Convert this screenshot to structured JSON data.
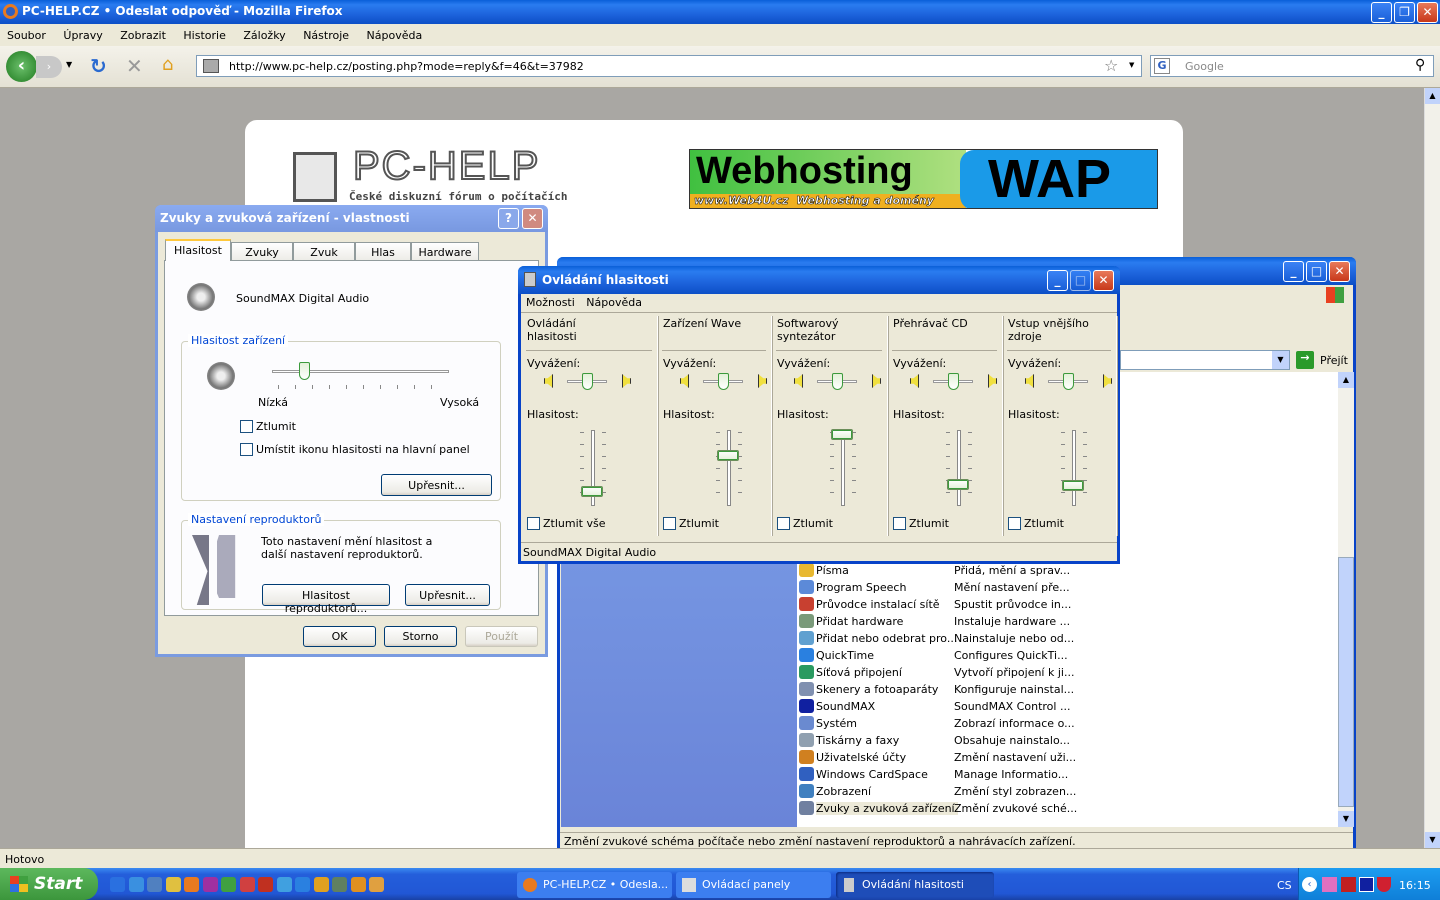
{
  "firefox": {
    "title": "PC-HELP.CZ • Odeslat odpověď - Mozilla Firefox",
    "menu": [
      "Soubor",
      "Úpravy",
      "Zobrazit",
      "Historie",
      "Záložky",
      "Nástroje",
      "Nápověda"
    ],
    "url": "http://www.pc-help.cz/posting.php?mode=reply&f=46&t=37982",
    "search_placeholder": "Google",
    "status": "Hotovo"
  },
  "page": {
    "logo_text": "PC-HELP",
    "logo_subtitle": "České diskuzní fórum o počítačích",
    "banner": {
      "main": "Webhosting",
      "sub": "www.Web4U.cz  Webhosting a domény",
      "right": "WAP"
    }
  },
  "sound_dialog": {
    "title": "Zvuky a zvuková zařízení - vlastnosti",
    "tabs": [
      "Hlasitost",
      "Zvuky",
      "Zvuk",
      "Hlas",
      "Hardware"
    ],
    "active_tab": 0,
    "device": "SoundMAX Digital Audio",
    "volume_group": "Hlasitost zařízení",
    "low": "Nízká",
    "high": "Vysoká",
    "volume_level": 0.18,
    "mute": "Ztlumit",
    "tray_icon": "Umístit ikonu hlasitosti na hlavní panel",
    "advanced": "Upřesnit...",
    "speaker_group": "Nastavení reproduktorů",
    "speaker_text": "Toto nastavení mění hlasitost a další nastavení reproduktorů.",
    "speaker_volume": "Hlasitost reproduktorů...",
    "speaker_advanced": "Upřesnit...",
    "ok": "OK",
    "cancel": "Storno",
    "apply": "Použít"
  },
  "mixer": {
    "title": "Ovládání hlasitosti",
    "menu": [
      "Možnosti",
      "Nápověda"
    ],
    "balance_label": "Vyvážení:",
    "volume_label": "Hlasitost:",
    "channels": [
      {
        "name": "Ovládání hlasitosti",
        "mute": "Ztlumit vše",
        "volume": 0.2
      },
      {
        "name": "Zařízení Wave",
        "mute": "Ztlumit",
        "volume": 0.67
      },
      {
        "name": "Softwarový syntezátor",
        "mute": "Ztlumit",
        "volume": 0.95
      },
      {
        "name": "Přehrávač CD",
        "mute": "Ztlumit",
        "volume": 0.29
      },
      {
        "name": "Vstup vnějšího zdroje",
        "mute": "Ztlumit",
        "volume": 0.27
      }
    ],
    "status": "SoundMAX Digital Audio"
  },
  "control_panel": {
    "go": "Přejít",
    "items": [
      {
        "name": "Písma",
        "desc": "Přidá, mění a sprav...",
        "color": "#e8b830"
      },
      {
        "name": "Program Speech",
        "desc": "Mění nastavení pře...",
        "color": "#5c8ad8"
      },
      {
        "name": "Průvodce instalací sítě",
        "desc": "Spustit průvodce in...",
        "color": "#c84030"
      },
      {
        "name": "Přidat hardware",
        "desc": "Instaluje hardware ...",
        "color": "#7a9a7a"
      },
      {
        "name": "Přidat nebo odebrat pro...",
        "desc": "Nainstaluje nebo od...",
        "color": "#60a0d0"
      },
      {
        "name": "QuickTime",
        "desc": "Configures QuickTi...",
        "color": "#2a80e0"
      },
      {
        "name": "Síťová připojení",
        "desc": "Vytvoří připojení k ji...",
        "color": "#2a9a60"
      },
      {
        "name": "Skenery a fotoaparáty",
        "desc": "Konfiguruje nainstal...",
        "color": "#8090b0"
      },
      {
        "name": "SoundMAX",
        "desc": "SoundMAX Control ...",
        "color": "#1020a0"
      },
      {
        "name": "Systém",
        "desc": "Zobrazí informace o...",
        "color": "#6a8ad0"
      },
      {
        "name": "Tiskárny a faxy",
        "desc": "Obsahuje nainstalo...",
        "color": "#90a0b0"
      },
      {
        "name": "Uživatelské účty",
        "desc": "Změní nastavení uži...",
        "color": "#d08020"
      },
      {
        "name": "Windows CardSpace",
        "desc": "Manage Informatio...",
        "color": "#3060c0"
      },
      {
        "name": "Zobrazení",
        "desc": "Změní styl zobrazen...",
        "color": "#4080c0"
      },
      {
        "name": "Zvuky a zvuková zařízení",
        "desc": "Změní zvukové sché...",
        "color": "#7080a0"
      }
    ],
    "status": "Změní zvukové schéma počítače nebo změní nastavení reproduktorů a nahrávacích zařízení."
  },
  "taskbar": {
    "start": "Start",
    "tasks": [
      "PC-HELP.CZ • Odesla...",
      "Ovládací panely",
      "Ovládání hlasitosti"
    ],
    "lang": "CS",
    "clock": "16:15"
  }
}
